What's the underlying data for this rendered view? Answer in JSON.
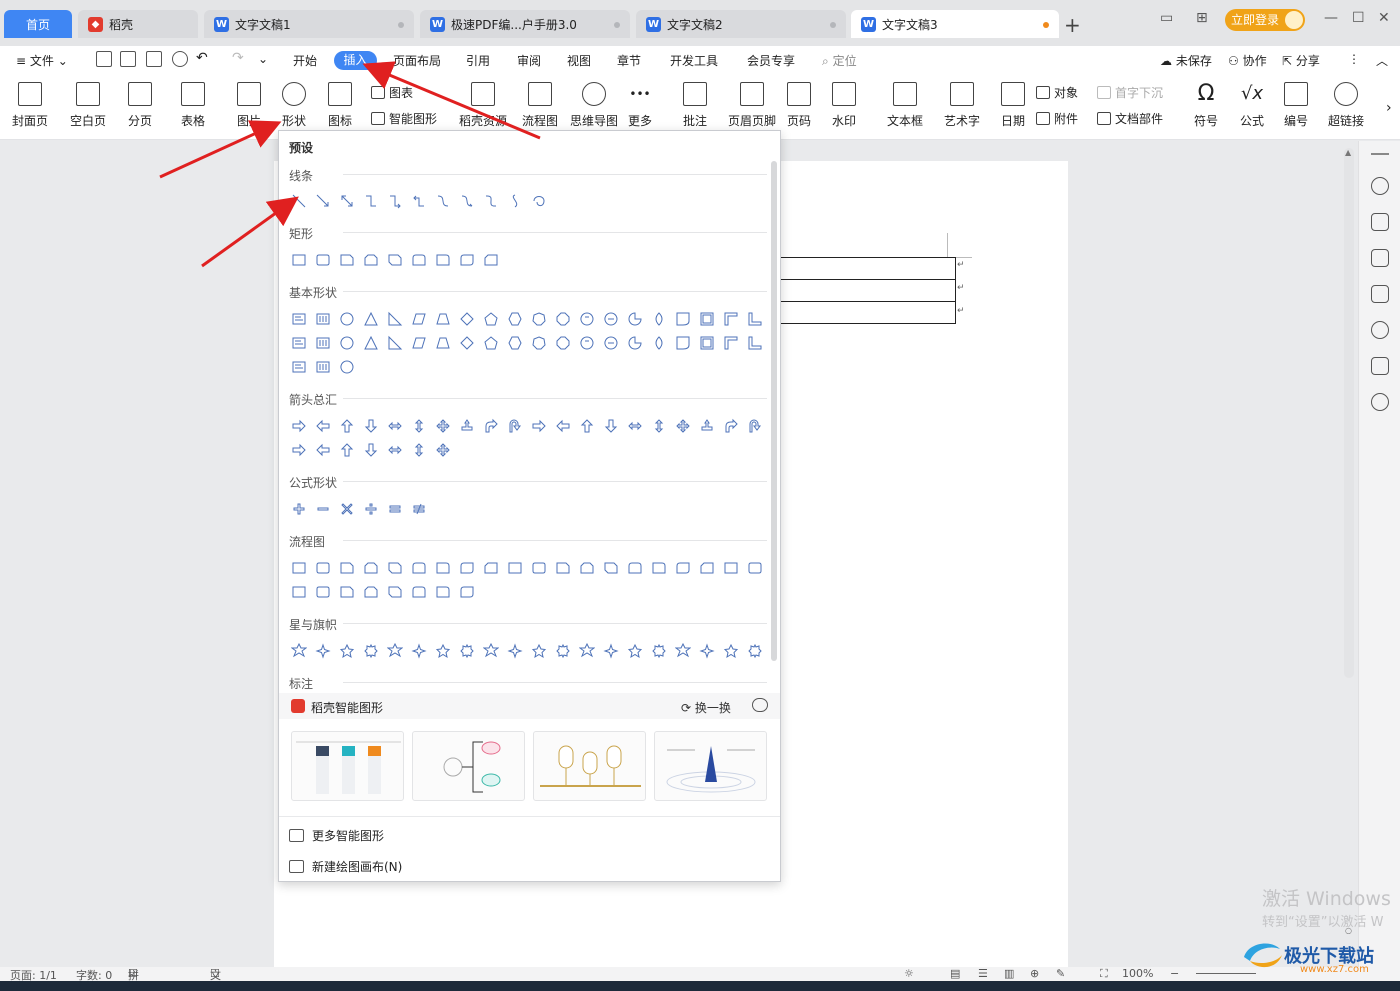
{
  "tabs": {
    "home": "首页",
    "items": [
      {
        "label": "稻壳",
        "icon": "docer-icon"
      },
      {
        "label": "文字文稿1",
        "icon": "writer-icon"
      },
      {
        "label": "极速PDF编...户手册3.0",
        "icon": "writer-icon"
      },
      {
        "label": "文字文稿2",
        "icon": "writer-icon"
      },
      {
        "label": "文字文稿3",
        "icon": "writer-icon"
      }
    ],
    "add": "+",
    "login": "立即登录"
  },
  "menu": {
    "file": "文件",
    "items": [
      "开始",
      "插入",
      "页面布局",
      "引用",
      "审阅",
      "视图",
      "章节",
      "开发工具",
      "会员专享"
    ],
    "locate": "定位",
    "unsaved": "未保存",
    "collab": "协作",
    "share": "分享"
  },
  "ribbon": {
    "cover": "封面页",
    "blank": "空白页",
    "pagebreak": "分页",
    "table": "表格",
    "picture": "图片",
    "shape": "形状",
    "iconlib": "图标",
    "chart": "图表",
    "smartart": "智能图形",
    "docer_res": "稻壳资源",
    "flowchart": "流程图",
    "mindmap": "思维导图",
    "more": "更多",
    "comment": "批注",
    "header_footer": "页眉页脚",
    "page_number": "页码",
    "watermark": "水印",
    "textbox": "文本框",
    "wordart": "艺术字",
    "date": "日期",
    "object": "对象",
    "attachment": "附件",
    "dropcap": "首字下沉",
    "docpart": "文档部件",
    "symbol": "符号",
    "formula": "公式",
    "numbering": "编号",
    "hyperlink": "超链接"
  },
  "dropdown": {
    "title": "预设",
    "sections": {
      "lines": "线条",
      "rect": "矩形",
      "basic": "基本形状",
      "arrows": "箭头总汇",
      "formula": "公式形状",
      "flow": "流程图",
      "stars": "星与旗帜",
      "callout": "标注"
    },
    "smart_title": "稻壳智能图形",
    "swap": "换一换",
    "more_smart": "更多智能图形",
    "new_canvas": "新建绘图画布(N)"
  },
  "status": {
    "page": "页面: 1/1",
    "words": "字数: 0",
    "spell": "拼写检查",
    "proof": "文档校对",
    "zoom": "100%"
  },
  "watermark": {
    "activate_line1": "激活 Windows",
    "activate_line2": "转到“设置”以激活 W",
    "site_name": "极光下载站",
    "site_url": "www.xz7.com"
  }
}
